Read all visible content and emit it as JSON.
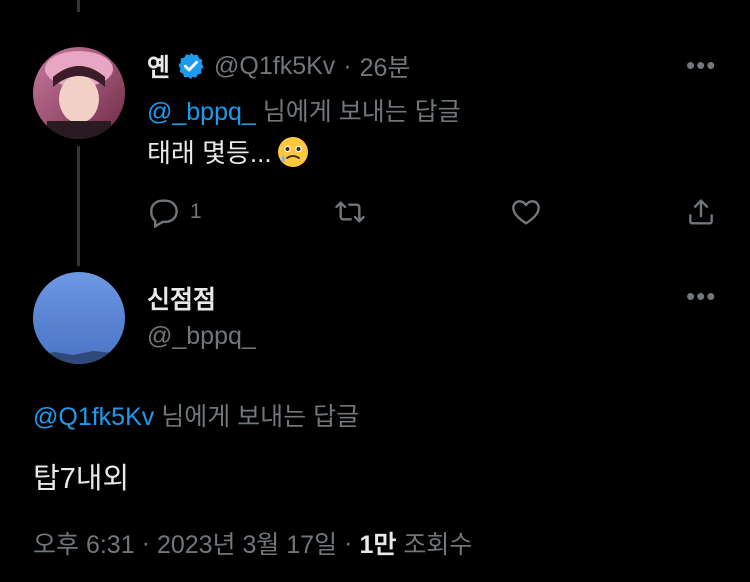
{
  "reply": {
    "author_name": "옌",
    "handle": "@Q1fk5Kv",
    "time": "26분",
    "separator": "·",
    "replying_to_handle": "@_bppq_",
    "replying_to_suffix": "님에게 보내는 답글",
    "text": "태래 몇등...",
    "emoji_icon": "face-holding-back-tears",
    "counts": {
      "replies": "1"
    }
  },
  "main_tweet": {
    "author_name": "신점점",
    "handle": "@_bppq_",
    "replying_to_handle": "@Q1fk5Kv",
    "replying_to_suffix": "님에게 보내는 답글",
    "text": "탑7내외",
    "meta": {
      "time": "오후 6:31",
      "sep1": "·",
      "date": "2023년 3월 17일",
      "sep2": "·",
      "views_count": "1만",
      "views_label": "조회수"
    }
  },
  "colors": {
    "accent": "#1d9bf0",
    "muted": "#71767b",
    "text": "#e7e9ea",
    "background": "#000000"
  }
}
